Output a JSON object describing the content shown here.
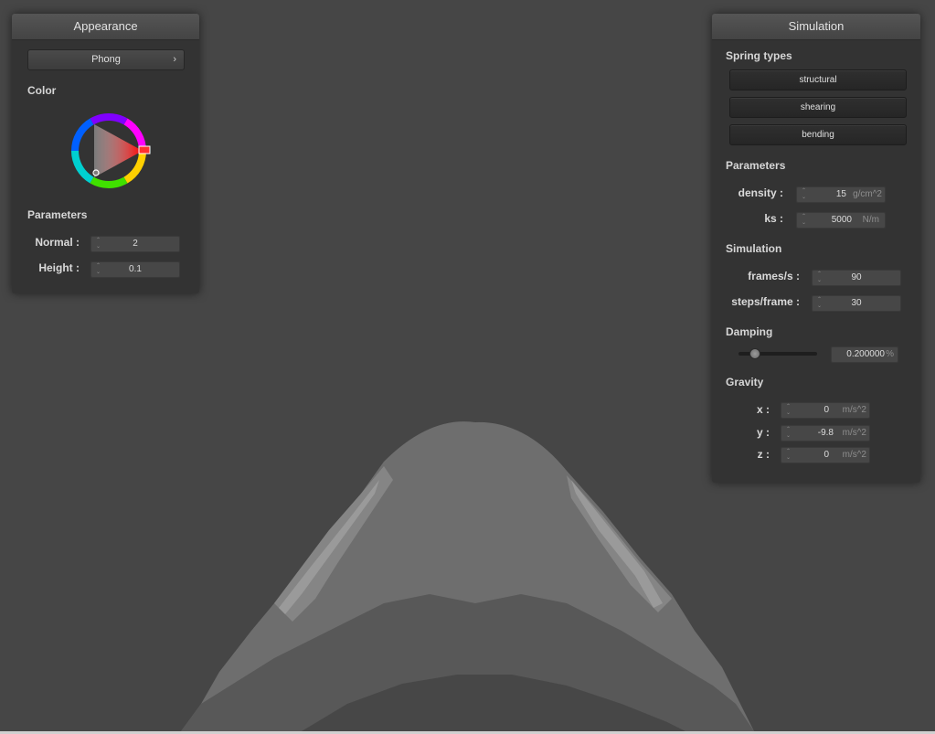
{
  "appearance": {
    "title": "Appearance",
    "shader_label": "Phong",
    "shader_chevron": "›",
    "color_section": "Color",
    "color_value": "#ff0000",
    "parameters_section": "Parameters",
    "normal_label": "Normal :",
    "normal_value": "2",
    "height_label": "Height :",
    "height_value": "0.1"
  },
  "simulation": {
    "title": "Simulation",
    "spring_types_section": "Spring types",
    "spring_buttons": [
      "structural",
      "shearing",
      "bending"
    ],
    "parameters_section": "Parameters",
    "density_label": "density :",
    "density_value": "15",
    "density_unit": "g/cm^2",
    "ks_label": "ks :",
    "ks_value": "5000",
    "ks_unit": "N/m",
    "simulation_section": "Simulation",
    "fps_label": "frames/s :",
    "fps_value": "90",
    "steps_label": "steps/frame :",
    "steps_value": "30",
    "damping_section": "Damping",
    "damping_value": "0.200000",
    "damping_unit": "%",
    "damping_slider_fraction": 0.2,
    "gravity_section": "Gravity",
    "gx_label": "x :",
    "gx_value": "0",
    "gy_label": "y :",
    "gy_value": "-9.8",
    "gz_label": "z :",
    "gz_value": "0",
    "gravity_unit": "m/s^2"
  },
  "icons": {
    "spinner": "updown-arrows-icon",
    "chevron": "chevron-right-icon"
  },
  "colors": {
    "background": "#464646",
    "panel": "#333333",
    "cloth": "#6a6a6a"
  }
}
